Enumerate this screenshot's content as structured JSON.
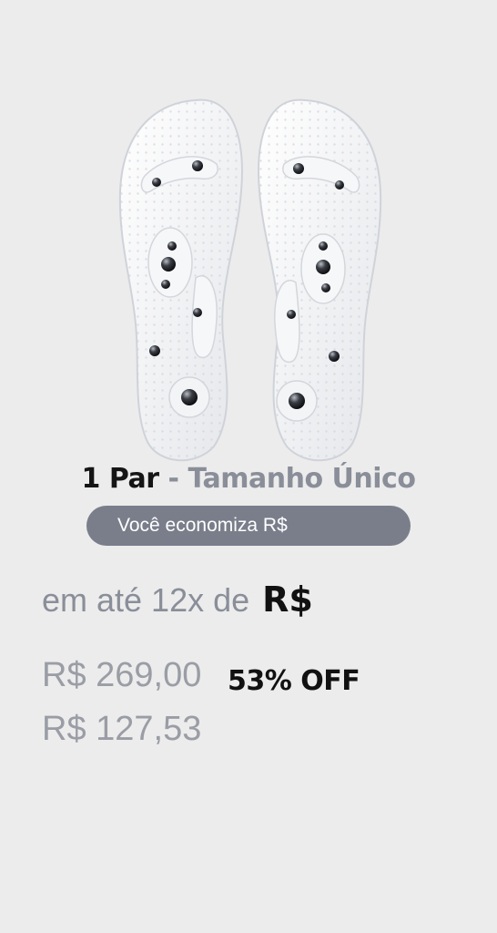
{
  "product": {
    "image_alt": "magnetic massage insoles",
    "quantity_label": "1 Par",
    "separator": "-",
    "size_label": "Tamanho Único"
  },
  "savings": {
    "label": "Você economiza R$"
  },
  "installments": {
    "text": "em até 12x de",
    "amount": "R$"
  },
  "pricing": {
    "old_price": "R$ 269,00",
    "discount": "53% OFF",
    "new_price": "R$ 127,53"
  }
}
